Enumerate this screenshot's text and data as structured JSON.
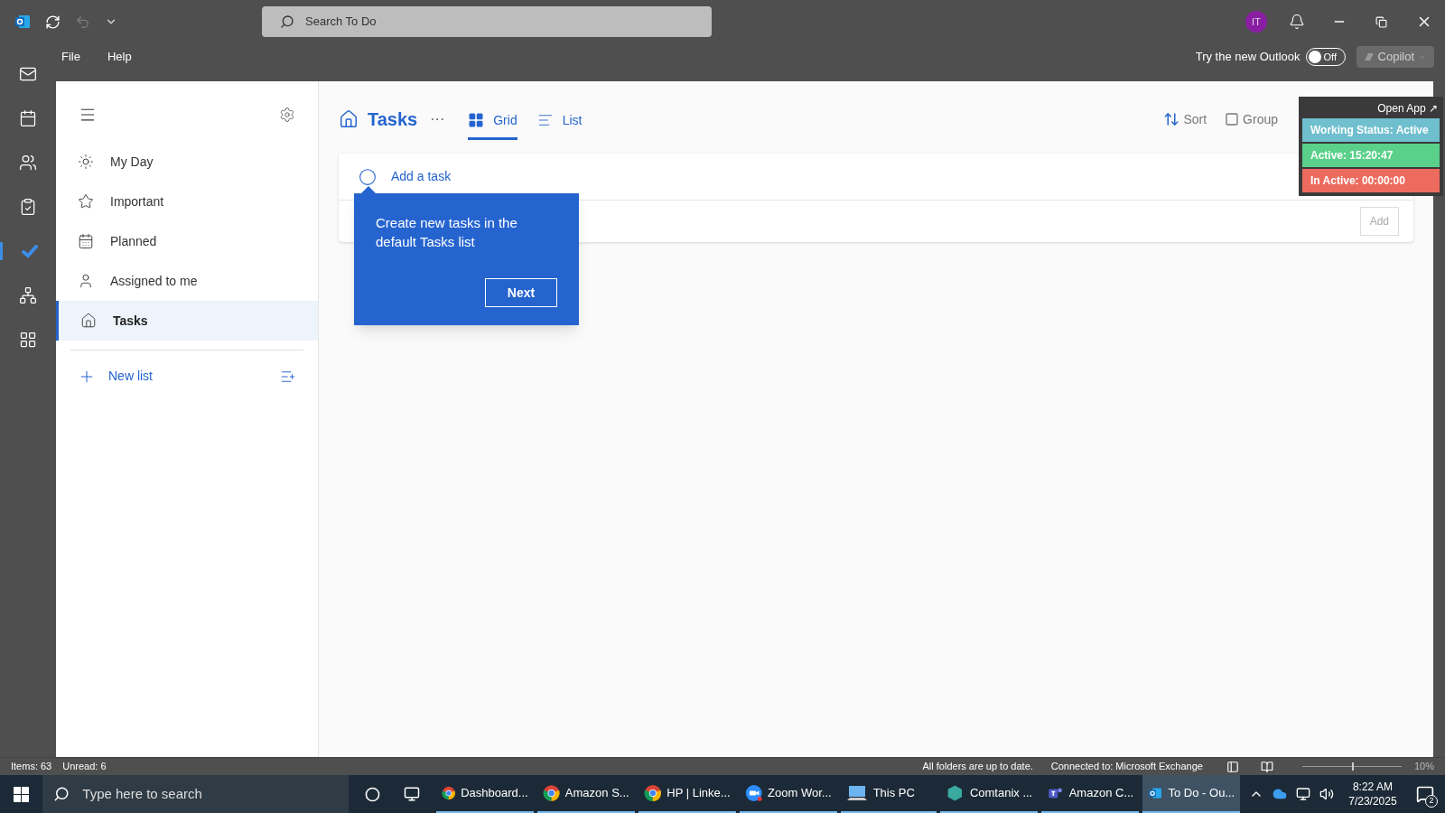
{
  "titlebar": {
    "search_placeholder": "Search To Do",
    "avatar": "IT"
  },
  "menu": [
    "File",
    "Help"
  ],
  "new_outlook": {
    "label": "Try the new Outlook",
    "toggle_label": "Off",
    "on": false,
    "copilot": "Copilot"
  },
  "rail": [
    {
      "kind": "mail",
      "selected": false
    },
    {
      "kind": "calendar",
      "selected": false
    },
    {
      "kind": "people",
      "selected": false
    },
    {
      "kind": "tasks",
      "selected": false
    },
    {
      "kind": "todo",
      "selected": true
    },
    {
      "kind": "groups",
      "selected": false
    },
    {
      "kind": "apps",
      "selected": false
    }
  ],
  "sidebar": {
    "items": [
      {
        "kind": "sun",
        "label": "My Day",
        "selected": false
      },
      {
        "kind": "star",
        "label": "Important",
        "selected": false
      },
      {
        "kind": "calendar",
        "label": "Planned",
        "selected": false
      },
      {
        "kind": "person",
        "label": "Assigned to me",
        "selected": false
      },
      {
        "kind": "home",
        "label": "Tasks",
        "selected": true
      }
    ],
    "new_list": "New list"
  },
  "main": {
    "title": "Tasks",
    "more": "···",
    "views": [
      {
        "kind": "grid",
        "label": "Grid",
        "selected": true
      },
      {
        "kind": "list",
        "label": "List",
        "selected": false
      }
    ],
    "sort": "Sort",
    "group": "Group",
    "add_task_placeholder": "Add a task",
    "add_button": "Add"
  },
  "coachmark": {
    "text": "Create new tasks in the default Tasks list",
    "button": "Next"
  },
  "status_widget": {
    "open_app": "Open App ↗",
    "rows": [
      {
        "text": "Working Status: Active",
        "color": "#6fbfcf"
      },
      {
        "text": "Active: 15:20:47",
        "color": "#5ad08a"
      },
      {
        "text": "In Active: 00:00:00",
        "color": "#ec6b5e"
      }
    ]
  },
  "status_bar": {
    "items": "Items: 63",
    "unread": "Unread: 6",
    "sync": "All folders are up to date.",
    "connection": "Connected to: Microsoft Exchange",
    "zoom": {
      "level": 0.5
    },
    "zoom_text": "10%"
  },
  "taskbar": {
    "search_placeholder": "Type here to search",
    "apps": [
      {
        "kind": "chrome",
        "label": "Dashboard...",
        "selected": false
      },
      {
        "kind": "chrome",
        "label": "Amazon S...",
        "selected": false
      },
      {
        "kind": "chrome",
        "label": "HP | Linke...",
        "selected": false
      },
      {
        "kind": "zoom",
        "label": "Zoom Wor...",
        "selected": false
      },
      {
        "kind": "pc",
        "label": "This PC",
        "selected": false
      },
      {
        "kind": "comtanix",
        "label": "Comtanix ...",
        "selected": false
      },
      {
        "kind": "teams",
        "label": "Amazon C...",
        "selected": false
      },
      {
        "kind": "outlook",
        "label": "To Do - Ou...",
        "selected": true
      }
    ],
    "time": "8:22 AM",
    "date": "7/23/2025",
    "notifications": "2"
  }
}
